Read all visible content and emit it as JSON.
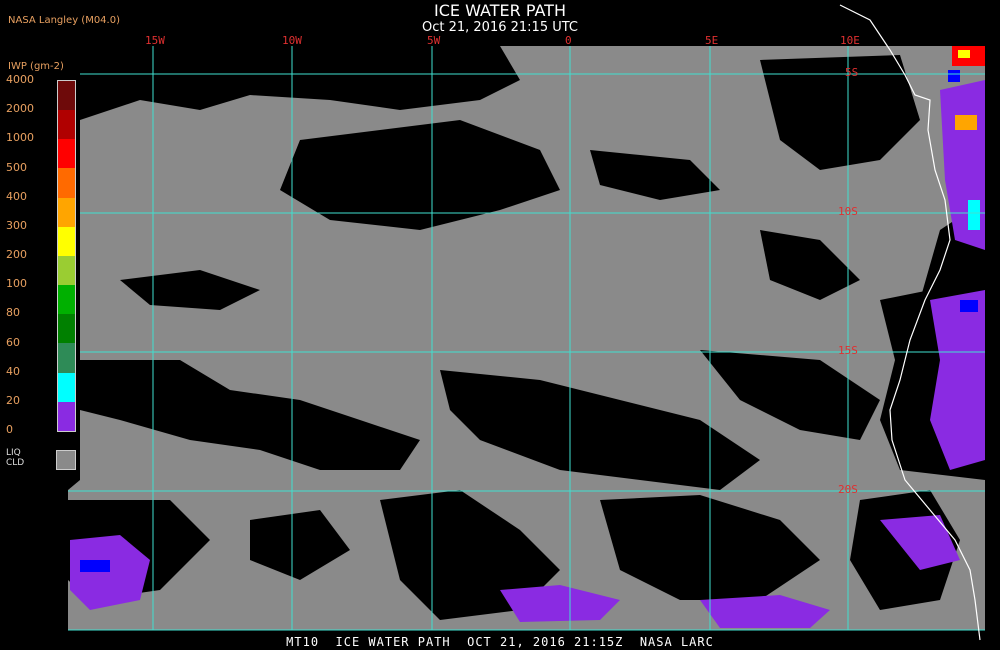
{
  "header": {
    "title": "ICE WATER PATH",
    "datetime": "Oct 21, 2016 21:15 UTC",
    "credit": "NASA Langley (M04.0)"
  },
  "legend": {
    "unit_label": "IWP (gm-2)",
    "items": [
      {
        "label": "4000",
        "color": "#6e0a0a"
      },
      {
        "label": "2000",
        "color": "#b00000"
      },
      {
        "label": "1000",
        "color": "#ff0000"
      },
      {
        "label": "500",
        "color": "#ff6a00"
      },
      {
        "label": "400",
        "color": "#ffa500"
      },
      {
        "label": "300",
        "color": "#ffff00"
      },
      {
        "label": "200",
        "color": "#9acd32"
      },
      {
        "label": "100",
        "color": "#00b000"
      },
      {
        "label": "80",
        "color": "#008000"
      },
      {
        "label": "60",
        "color": "#2e8b57"
      },
      {
        "label": "40",
        "color": "#00ffff"
      },
      {
        "label": "20",
        "color": "#0080ff"
      },
      {
        "label": "0",
        "color": "#0000ff"
      }
    ],
    "liquid_cloud_label": "LIQ\nCLD",
    "liquid_cloud_color": "#8a8a8a",
    "zero_color": "#8a2be2"
  },
  "map": {
    "longitude_labels": [
      "15W",
      "10W",
      "5W",
      "0",
      "5E",
      "10E"
    ],
    "latitude_labels": [
      "5S",
      "10S",
      "15S",
      "20S"
    ],
    "grid_color": "#40e0d0",
    "cloud_color": "#8a8a8a",
    "ice_color": "#8a2be2",
    "coast_color": "#ffffff"
  },
  "footer": {
    "text": "MT10  ICE WATER PATH  OCT 21, 2016 21:15Z  NASA LARC"
  }
}
